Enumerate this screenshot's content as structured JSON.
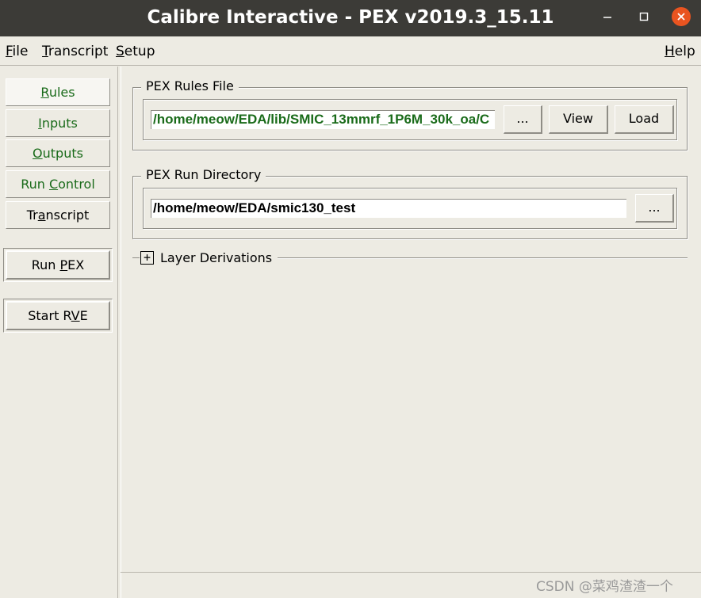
{
  "window": {
    "title": "Calibre Interactive - PEX v2019.3_15.11",
    "colors": {
      "titlebar": "#3c3b37",
      "close": "#e95420",
      "green_text": "#1a6b1a",
      "bg": "#edebe3"
    }
  },
  "menu": {
    "file": {
      "u": "F",
      "rest": "ile"
    },
    "transcript": {
      "u": "T",
      "rest": "ranscript"
    },
    "setup": {
      "u": "S",
      "rest": "etup"
    },
    "help": {
      "u": "H",
      "rest": "elp"
    }
  },
  "sidebar": {
    "rules": {
      "u": "R",
      "rest": "ules"
    },
    "inputs": {
      "u": "I",
      "rest": "nputs"
    },
    "outputs": {
      "u": "O",
      "rest": "utputs"
    },
    "run_control": {
      "pre": "Run ",
      "u": "C",
      "rest": "ontrol"
    },
    "transcript": {
      "pre": "Tr",
      "u": "a",
      "rest": "nscript"
    },
    "run_pex": {
      "pre": "Run ",
      "u": "P",
      "rest": "EX"
    },
    "start_rve": {
      "pre": "Start R",
      "u": "V",
      "rest": "E"
    }
  },
  "rules_file": {
    "label": "PEX Rules File",
    "value": "/home/meow/EDA/lib/SMIC_13mmrf_1P6M_30k_oa/C",
    "browse": "...",
    "view": "View",
    "load": "Load"
  },
  "run_dir": {
    "label": "PEX Run Directory",
    "value": "/home/meow/EDA/smic130_test",
    "browse": "..."
  },
  "layer_derivations": {
    "toggle": "+",
    "label": "Layer Derivations"
  },
  "watermark": "CSDN @菜鸡渣渣一个"
}
